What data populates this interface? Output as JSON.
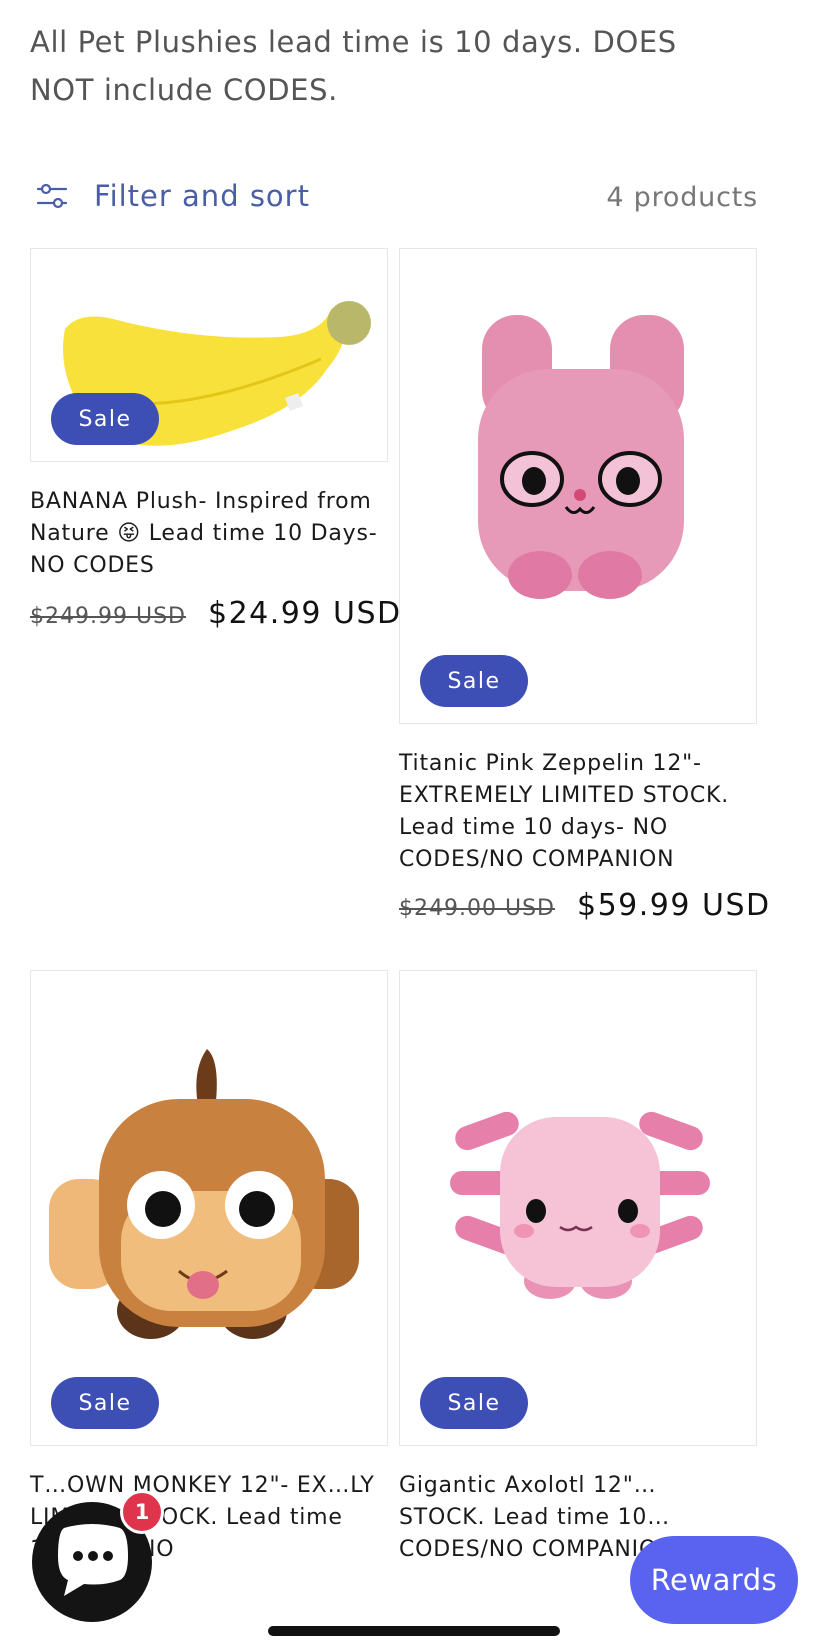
{
  "intro_text": "All Pet Plushies lead time is 10 days.  DOES NOT include CODES.",
  "filter": {
    "label": "Filter and sort",
    "count": "4 products",
    "icon": "sliders-icon"
  },
  "products": [
    {
      "badge": "Sale",
      "title": "BANANA Plush- Inspired from Nature 😝 Lead time 10 Days- NO CODES",
      "price_old": "$249.99 USD",
      "price_new": "$24.99 USD"
    },
    {
      "badge": "Sale",
      "title": "Titanic Pink Zeppelin 12\"- EXTREMELY LIMITED STOCK. Lead time 10 days- NO CODES/NO COMPANION",
      "price_old": "$249.00 USD",
      "price_new": "$59.99 USD"
    },
    {
      "badge": "Sale",
      "title": "T…OWN MONKEY 12\"- EX…LY LIMITED STOCK. Lead time 10 days- NO"
    },
    {
      "badge": "Sale",
      "title": "Gigantic Axolotl 12\"… STOCK. Lead time 10… CODES/NO COMPANION"
    }
  ],
  "chat": {
    "icon": "chat-bubble-icon",
    "badge_count": "1"
  },
  "rewards": {
    "label": "Rewards"
  },
  "colors": {
    "accent": "#3d4fb5",
    "rewards": "#5a63f0",
    "filter_text": "#4a5ea8",
    "badge_red": "#e0344d"
  }
}
